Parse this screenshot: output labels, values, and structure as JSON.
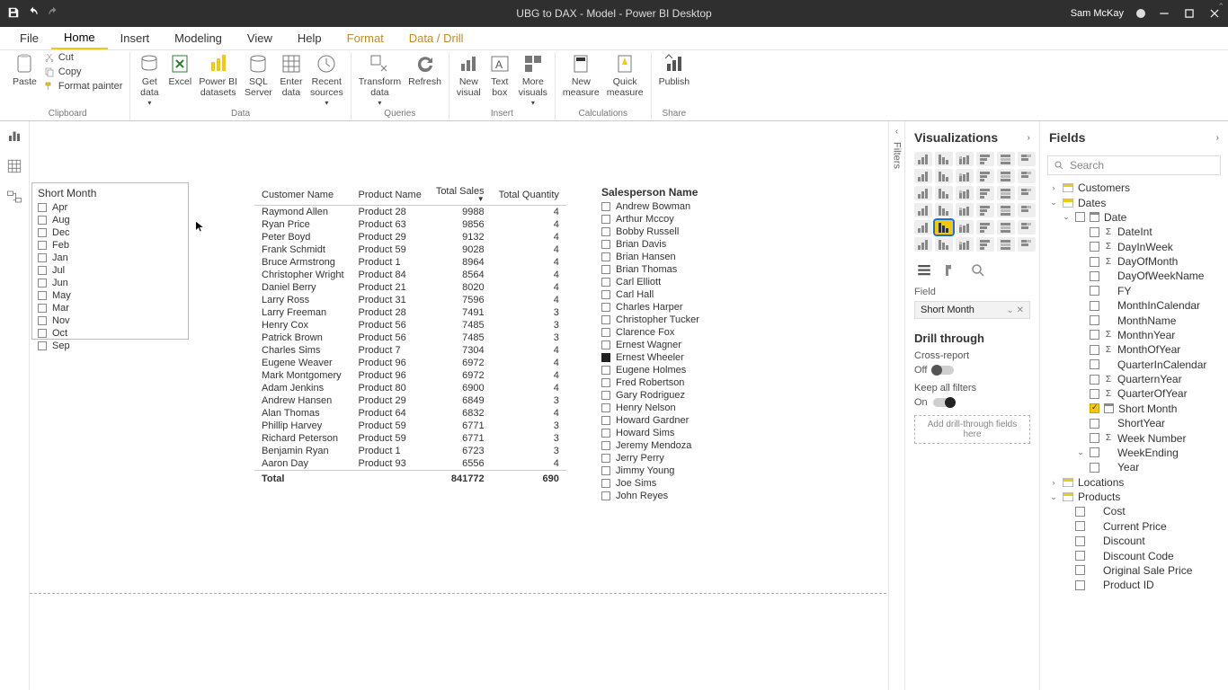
{
  "titlebar": {
    "title": "UBG to DAX - Model - Power BI Desktop",
    "user": "Sam McKay"
  },
  "tabs": {
    "file": "File",
    "home": "Home",
    "insert": "Insert",
    "modeling": "Modeling",
    "view": "View",
    "help": "Help",
    "format": "Format",
    "datadrill": "Data / Drill"
  },
  "ribbon": {
    "clipboard": {
      "label": "Clipboard",
      "paste": "Paste",
      "cut": "Cut",
      "copy": "Copy",
      "painter": "Format painter"
    },
    "data": {
      "label": "Data",
      "getdata": "Get\ndata",
      "excel": "Excel",
      "pbidatasets": "Power BI\ndatasets",
      "sqlserver": "SQL\nServer",
      "enterdata": "Enter\ndata",
      "recent": "Recent\nsources"
    },
    "queries": {
      "label": "Queries",
      "transform": "Transform\ndata",
      "refresh": "Refresh"
    },
    "insert": {
      "label": "Insert",
      "newvisual": "New\nvisual",
      "textbox": "Text\nbox",
      "morevisuals": "More\nvisuals"
    },
    "calc": {
      "label": "Calculations",
      "newmeasure": "New\nmeasure",
      "quickmeasure": "Quick\nmeasure"
    },
    "share": {
      "label": "Share",
      "publish": "Publish"
    }
  },
  "filtersRail": "Filters",
  "monthSlicer": {
    "title": "Short Month",
    "items": [
      "Apr",
      "Aug",
      "Dec",
      "Feb",
      "Jan",
      "Jul",
      "Jun",
      "May",
      "Mar",
      "Nov",
      "Oct",
      "Sep"
    ]
  },
  "table": {
    "headers": {
      "customer": "Customer Name",
      "product": "Product Name",
      "sales": "Total Sales",
      "qty": "Total Quantity"
    },
    "rows": [
      [
        "Raymond Allen",
        "Product 28",
        "9988",
        "4"
      ],
      [
        "Ryan Price",
        "Product 63",
        "9856",
        "4"
      ],
      [
        "Peter Boyd",
        "Product 29",
        "9132",
        "4"
      ],
      [
        "Frank Schmidt",
        "Product 59",
        "9028",
        "4"
      ],
      [
        "Bruce Armstrong",
        "Product 1",
        "8964",
        "4"
      ],
      [
        "Christopher Wright",
        "Product 84",
        "8564",
        "4"
      ],
      [
        "Daniel Berry",
        "Product 21",
        "8020",
        "4"
      ],
      [
        "Larry Ross",
        "Product 31",
        "7596",
        "4"
      ],
      [
        "Larry Freeman",
        "Product 28",
        "7491",
        "3"
      ],
      [
        "Henry Cox",
        "Product 56",
        "7485",
        "3"
      ],
      [
        "Patrick Brown",
        "Product 56",
        "7485",
        "3"
      ],
      [
        "Charles Sims",
        "Product 7",
        "7304",
        "4"
      ],
      [
        "Eugene Weaver",
        "Product 96",
        "6972",
        "4"
      ],
      [
        "Mark Montgomery",
        "Product 96",
        "6972",
        "4"
      ],
      [
        "Adam Jenkins",
        "Product 80",
        "6900",
        "4"
      ],
      [
        "Andrew Hansen",
        "Product 29",
        "6849",
        "3"
      ],
      [
        "Alan Thomas",
        "Product 64",
        "6832",
        "4"
      ],
      [
        "Phillip Harvey",
        "Product 59",
        "6771",
        "3"
      ],
      [
        "Richard Peterson",
        "Product 59",
        "6771",
        "3"
      ],
      [
        "Benjamin Ryan",
        "Product 1",
        "6723",
        "3"
      ],
      [
        "Aaron Day",
        "Product 93",
        "6556",
        "4"
      ]
    ],
    "footer": {
      "label": "Total",
      "sales": "841772",
      "qty": "690"
    }
  },
  "salesSlicer": {
    "title": "Salesperson Name",
    "items": [
      {
        "n": "Andrew Bowman",
        "c": false
      },
      {
        "n": "Arthur Mccoy",
        "c": false
      },
      {
        "n": "Bobby Russell",
        "c": false
      },
      {
        "n": "Brian Davis",
        "c": false
      },
      {
        "n": "Brian Hansen",
        "c": false
      },
      {
        "n": "Brian Thomas",
        "c": false
      },
      {
        "n": "Carl Elliott",
        "c": false
      },
      {
        "n": "Carl Hall",
        "c": false
      },
      {
        "n": "Charles Harper",
        "c": false
      },
      {
        "n": "Christopher Tucker",
        "c": false
      },
      {
        "n": "Clarence Fox",
        "c": false
      },
      {
        "n": "Ernest Wagner",
        "c": false
      },
      {
        "n": "Ernest Wheeler",
        "c": true
      },
      {
        "n": "Eugene Holmes",
        "c": false
      },
      {
        "n": "Fred Robertson",
        "c": false
      },
      {
        "n": "Gary Rodriguez",
        "c": false
      },
      {
        "n": "Henry Nelson",
        "c": false
      },
      {
        "n": "Howard Gardner",
        "c": false
      },
      {
        "n": "Howard Sims",
        "c": false
      },
      {
        "n": "Jeremy Mendoza",
        "c": false
      },
      {
        "n": "Jerry Perry",
        "c": false
      },
      {
        "n": "Jimmy Young",
        "c": false
      },
      {
        "n": "Joe Sims",
        "c": false
      },
      {
        "n": "John Reyes",
        "c": false
      }
    ]
  },
  "viz": {
    "title": "Visualizations",
    "fieldLabel": "Field",
    "fieldValue": "Short Month",
    "drill": "Drill through",
    "cross": "Cross-report",
    "crossState": "Off",
    "keep": "Keep all filters",
    "keepState": "On",
    "drop": "Add drill-through fields here"
  },
  "fields": {
    "title": "Fields",
    "searchPlaceholder": "Search",
    "tables": {
      "customers": "Customers",
      "dates": "Dates",
      "dateCol": "Date",
      "dateChildren": [
        {
          "n": "DateInt",
          "s": true
        },
        {
          "n": "DayInWeek",
          "s": true
        },
        {
          "n": "DayOfMonth",
          "s": true
        },
        {
          "n": "DayOfWeekName",
          "s": false
        },
        {
          "n": "FY",
          "s": false
        },
        {
          "n": "MonthInCalendar",
          "s": false
        },
        {
          "n": "MonthName",
          "s": false
        },
        {
          "n": "MonthnYear",
          "s": true
        },
        {
          "n": "MonthOfYear",
          "s": true
        },
        {
          "n": "QuarterInCalendar",
          "s": false
        },
        {
          "n": "QuarternYear",
          "s": true
        },
        {
          "n": "QuarterOfYear",
          "s": true
        },
        {
          "n": "Short Month",
          "s": false,
          "checked": true,
          "cal": true
        },
        {
          "n": "ShortYear",
          "s": false
        },
        {
          "n": "Week Number",
          "s": true
        },
        {
          "n": "WeekEnding",
          "s": false,
          "expand": true
        },
        {
          "n": "Year",
          "s": false
        }
      ],
      "locations": "Locations",
      "products": "Products",
      "productChildren": [
        {
          "n": "Cost"
        },
        {
          "n": "Current Price"
        },
        {
          "n": "Discount"
        },
        {
          "n": "Discount Code"
        },
        {
          "n": "Original Sale Price"
        },
        {
          "n": "Product ID"
        }
      ]
    }
  }
}
